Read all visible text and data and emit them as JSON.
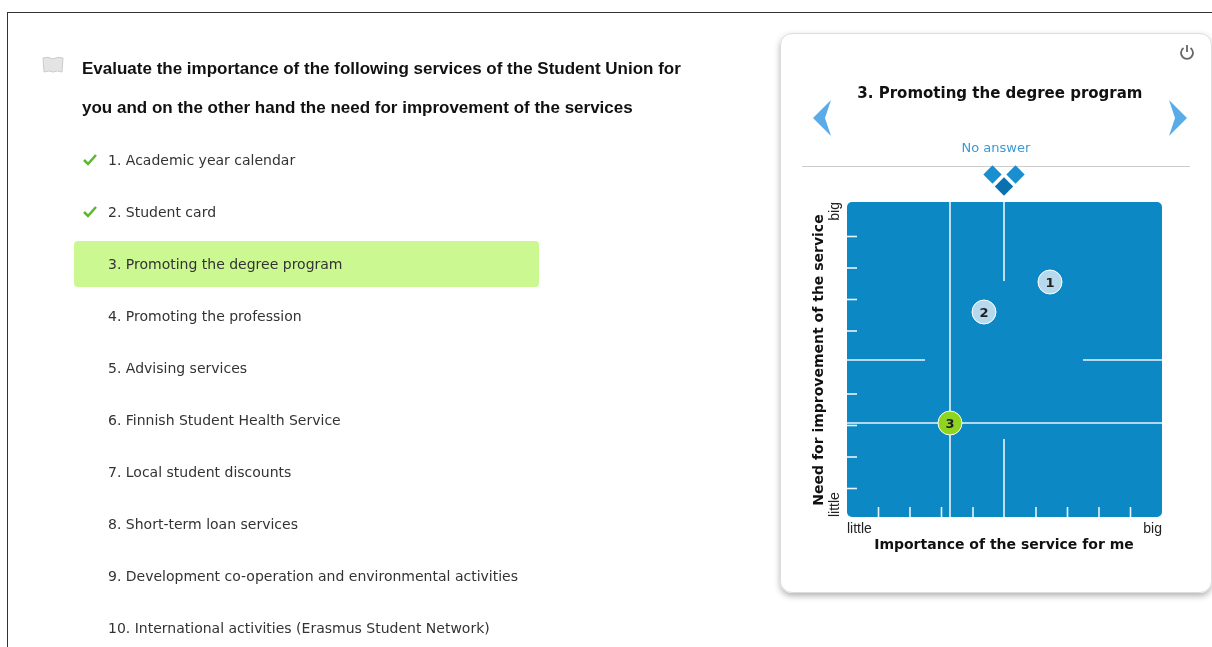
{
  "question": {
    "title": "Evaluate the importance of the following services of the Student Union for you and on the other hand the need for improvement of the services"
  },
  "items": [
    {
      "label": "1. Academic year calendar",
      "answered": true,
      "selected": false
    },
    {
      "label": "2. Student card",
      "answered": true,
      "selected": false
    },
    {
      "label": "3. Promoting the degree program",
      "answered": false,
      "selected": true
    },
    {
      "label": "4. Promoting the profession",
      "answered": false,
      "selected": false
    },
    {
      "label": "5. Advising services",
      "answered": false,
      "selected": false
    },
    {
      "label": "6. Finnish Student Health Service",
      "answered": false,
      "selected": false
    },
    {
      "label": "7. Local student discounts",
      "answered": false,
      "selected": false
    },
    {
      "label": "8. Short-term loan services",
      "answered": false,
      "selected": false
    },
    {
      "label": "9. Development co-operation and environmental activities",
      "answered": false,
      "selected": false
    },
    {
      "label": "10. International activities (Erasmus Student Network)",
      "answered": false,
      "selected": false
    }
  ],
  "panel": {
    "title": "3. Promoting the degree program",
    "status": "No answer",
    "board": {
      "x_axis": {
        "title": "Importance of the service for me",
        "min_label": "little",
        "max_label": "big"
      },
      "y_axis": {
        "title": "Need for improvement of the service",
        "min_label": "little",
        "max_label": "big"
      },
      "markers": [
        {
          "label": "1",
          "selected": false
        },
        {
          "label": "2",
          "selected": false
        },
        {
          "label": "3",
          "selected": true
        }
      ]
    }
  }
}
